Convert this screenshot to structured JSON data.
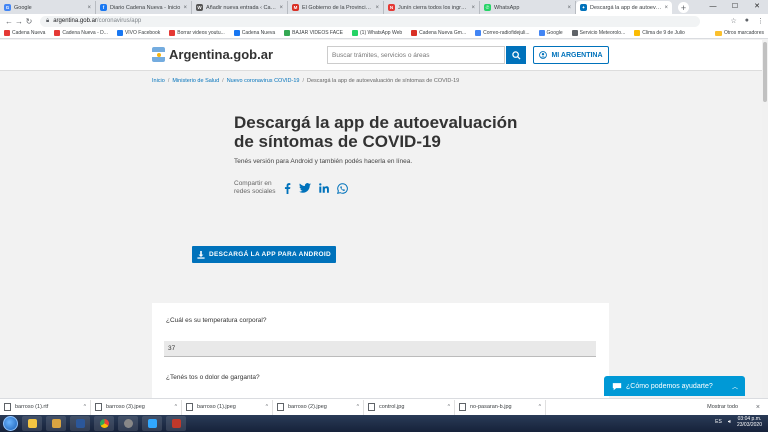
{
  "browser": {
    "tabs": [
      {
        "label": "Google",
        "color": "#4285f4",
        "glyph": "G"
      },
      {
        "label": "Diario Cadena Nueva - Inicio",
        "color": "#1877f2",
        "glyph": "f"
      },
      {
        "label": "Añadir nueva entrada ‹ Cadena N",
        "color": "#555555",
        "glyph": "W"
      },
      {
        "label": "El Gobierno de la Provincia pone",
        "color": "#d93025",
        "glyph": "M"
      },
      {
        "label": "Junín cierra todos los ingresos a",
        "color": "#e53935",
        "glyph": "CN"
      },
      {
        "label": "WhatsApp",
        "color": "#25d366",
        "glyph": "✆"
      },
      {
        "label": "Descargá la app de autoevaluación",
        "color": "#0072bb",
        "glyph": "✦"
      }
    ],
    "url_host": "argentina.gob.ar",
    "url_path": "/coronavirus/app",
    "bookmarks": [
      {
        "label": "Cadena Nueva",
        "color": "#e53935"
      },
      {
        "label": "Cadena Nueva - D...",
        "color": "#e53935"
      },
      {
        "label": "VIVO Facebook",
        "color": "#1877f2"
      },
      {
        "label": "Borrar videos youtu...",
        "color": "#e53935"
      },
      {
        "label": "Cadena Nueva",
        "color": "#1877f2"
      },
      {
        "label": "BAJAR VIDEOS FACE",
        "color": "#34a853"
      },
      {
        "label": "(1) WhatsApp Web",
        "color": "#25d366"
      },
      {
        "label": "Cadena Nueva Gm...",
        "color": "#d93025"
      },
      {
        "label": "Correo-radiofidejuli...",
        "color": "#4285f4"
      },
      {
        "label": "Google",
        "color": "#4285f4"
      },
      {
        "label": "Servicio Meteorolo...",
        "color": "#5f6368"
      },
      {
        "label": "Clima de 9 de Julio",
        "color": "#fbbc04"
      }
    ],
    "bookmarks_other": "Otros marcadores"
  },
  "header": {
    "brand": "Argentina.gob.ar",
    "search_placeholder": "Buscar trámites, servicios o áreas",
    "mi_argentina": "MI ARGENTINA"
  },
  "breadcrumb": {
    "items": [
      "Inicio",
      "Ministerio de Salud",
      "Nuevo coronavirus COVID-19"
    ],
    "current": "Descargá la app de autoevaluación de síntomas de COVID-19"
  },
  "hero": {
    "title": "Descargá la app de autoevaluación de síntomas de COVID-19",
    "subtitle": "Tenés versión para Android y también podés hacerla en línea.",
    "share_label": "Compartir en redes sociales",
    "download_button": "DESCARGÁ LA APP PARA ANDROID"
  },
  "form": {
    "q1": "¿Cuál es su temperatura corporal?",
    "a1": "37",
    "q2": "¿Tenés tos o dolor de garganta?"
  },
  "chat": {
    "label": "¿Cómo podemos ayudarte?"
  },
  "downloads": {
    "files": [
      "barroso (1).rtf",
      "barroso (3).jpeg",
      "barroso (1).jpeg",
      "barroso (2).jpeg",
      "control.jpg",
      "no-pasaran-b.jpg"
    ],
    "show_all": "Mostrar todo"
  },
  "taskbar": {
    "lang": "ES",
    "time": "03:04 p.m.",
    "date": "23/03/2020"
  }
}
